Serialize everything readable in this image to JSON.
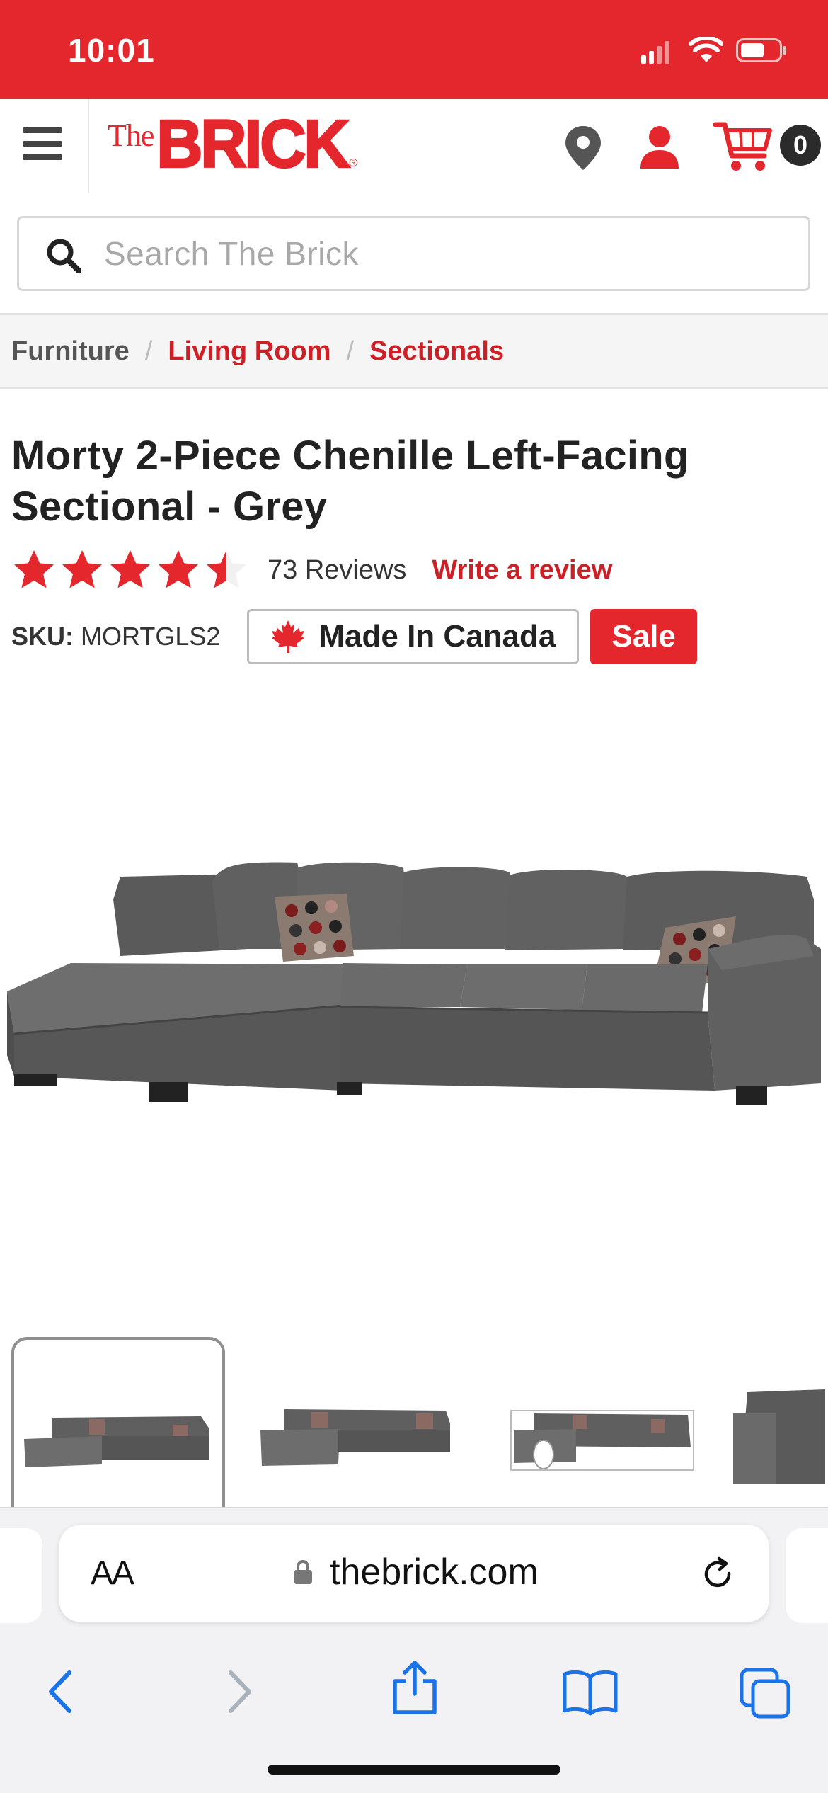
{
  "status_bar": {
    "time": "10:01"
  },
  "header": {
    "logo_the": "The",
    "logo_brick": "BRICK",
    "cart_count": "0",
    "brand_color": "#e4262d"
  },
  "search": {
    "placeholder": "Search The Brick"
  },
  "breadcrumb": {
    "items": [
      "Furniture",
      "Living Room",
      "Sectionals"
    ],
    "separator": "/"
  },
  "product": {
    "title": "Morty 2-Piece Chenille Left-Facing Sectional - Grey",
    "rating": 4.5,
    "rating_max": 5,
    "reviews_label": "73 Reviews",
    "write_review": "Write a review",
    "sku_label": "SKU:",
    "sku_value": "MORTGLS2",
    "made_in_label": "Made In Canada",
    "sale_label": "Sale",
    "image_alt_icon": "sectional-sofa-image"
  },
  "thumbnails": {
    "count_visible": 4,
    "selected_index": 0
  },
  "browser": {
    "text_size_label": "AA",
    "url": "thebrick.com",
    "icons": [
      "back-icon",
      "forward-icon",
      "share-icon",
      "bookmarks-icon",
      "tabs-icon"
    ],
    "accent_color": "#1a73e8"
  }
}
